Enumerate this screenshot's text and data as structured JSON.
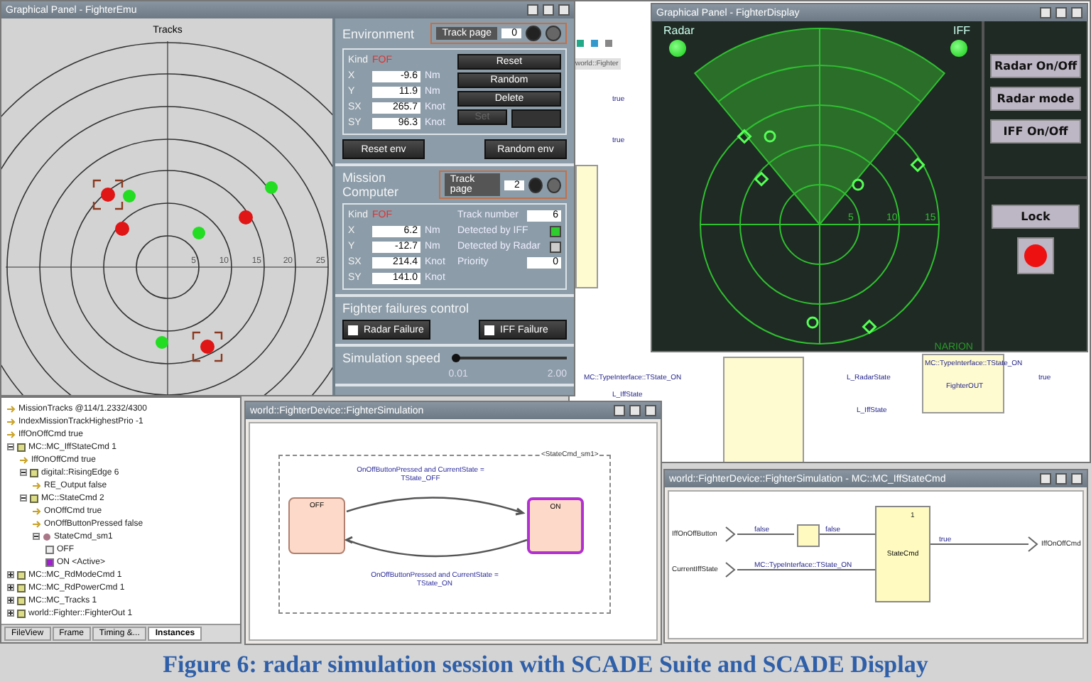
{
  "emu_window": {
    "title": "Graphical Panel - FighterEmu",
    "radar": {
      "title": "Tracks",
      "ticks": [
        "5",
        "10",
        "15",
        "20",
        "25"
      ]
    },
    "environment": {
      "title": "Environment",
      "track_page_label": "Track page",
      "track_page": "0",
      "kind_label": "Kind",
      "kind": "FOF",
      "fields": [
        {
          "label": "X",
          "value": "-9.6",
          "unit": "Nm"
        },
        {
          "label": "Y",
          "value": "11.9",
          "unit": "Nm"
        },
        {
          "label": "SX",
          "value": "265.7",
          "unit": "Knot"
        },
        {
          "label": "SY",
          "value": "96.3",
          "unit": "Knot"
        }
      ],
      "buttons": [
        {
          "label": "Reset",
          "disabled": false
        },
        {
          "label": "Random",
          "disabled": false
        },
        {
          "label": "Delete",
          "disabled": false
        }
      ],
      "set_button": {
        "label": "Set",
        "disabled": true
      },
      "actions": [
        "Reset env",
        "Random env"
      ]
    },
    "mission_computer": {
      "title": "Mission Computer",
      "track_page_label": "Track page",
      "track_page": "2",
      "kind_label": "Kind",
      "kind": "FOF",
      "fields": [
        {
          "label": "X",
          "value": "6.2",
          "unit": "Nm"
        },
        {
          "label": "Y",
          "value": "-12.7",
          "unit": "Nm"
        },
        {
          "label": "SX",
          "value": "214.4",
          "unit": "Knot"
        },
        {
          "label": "SY",
          "value": "141.0",
          "unit": "Knot"
        }
      ],
      "props": [
        {
          "kind": "number",
          "label": "Track number",
          "value": "6"
        },
        {
          "kind": "check",
          "label": "Detected by IFF",
          "checked": true
        },
        {
          "kind": "check",
          "label": "Detected by Radar",
          "checked": false
        },
        {
          "kind": "number",
          "label": "Priority",
          "value": "0"
        }
      ]
    },
    "failures": {
      "title": "Fighter failures control",
      "items": [
        {
          "label": "Radar Failure",
          "checked": false
        },
        {
          "label": "IFF Failure",
          "checked": false
        }
      ]
    },
    "speed": {
      "title": "Simulation speed",
      "level": 0.02,
      "min": "0.01",
      "max": "2.00"
    }
  },
  "display_window": {
    "title": "Graphical Panel - FighterDisplay",
    "lamps": [
      {
        "label": "Radar",
        "on": true
      },
      {
        "label": "IFF",
        "on": true
      }
    ],
    "ticks": [
      "5",
      "10",
      "15"
    ],
    "brand": "NARION",
    "buttons": [
      "Radar On/Off",
      "Radar mode",
      "IFF On/Off"
    ],
    "lock": {
      "label": "Lock",
      "on": true
    }
  },
  "editor_window": {
    "tab": "world::Fighter",
    "labels": [
      "true",
      "true",
      "MC::TypeInterface::TState_ON",
      "L_IffState",
      "L_RadarState",
      "L_IffState",
      "MC::TypeInterface::TState_ON",
      "FighterOUT",
      "true"
    ]
  },
  "tree_window": {
    "items": [
      {
        "kind": "value",
        "label": "MissionTracks @114/1.2332/4300"
      },
      {
        "kind": "value",
        "label": "IndexMissionTrackHighestPrio -1"
      },
      {
        "kind": "value",
        "label": "IffOnOffCmd true"
      },
      {
        "kind": "group",
        "label": "MC::MC_IffStateCmd 1",
        "expanded": true,
        "children": [
          {
            "kind": "value",
            "label": "IffOnOffCmd true"
          },
          {
            "kind": "group",
            "label": "digital::RisingEdge 6",
            "expanded": true,
            "children": [
              {
                "kind": "value",
                "label": "RE_Output false"
              }
            ]
          },
          {
            "kind": "group",
            "label": "MC::StateCmd 2",
            "expanded": true,
            "children": [
              {
                "kind": "value",
                "label": "OnOffCmd true"
              },
              {
                "kind": "value",
                "label": "OnOffButtonPressed false"
              },
              {
                "kind": "machine",
                "label": "StateCmd_sm1",
                "expanded": true,
                "children": [
                  {
                    "kind": "state",
                    "label": "OFF",
                    "active": false
                  },
                  {
                    "kind": "state",
                    "label": "ON <Active>",
                    "active": true
                  }
                ]
              }
            ]
          }
        ]
      },
      {
        "kind": "group",
        "label": "MC::MC_RdModeCmd 1",
        "expanded": false
      },
      {
        "kind": "group",
        "label": "MC::MC_RdPowerCmd 1",
        "expanded": false
      },
      {
        "kind": "group",
        "label": "MC::MC_Tracks 1",
        "expanded": false
      },
      {
        "kind": "group",
        "label": "world::Fighter::FighterOut 1",
        "expanded": false
      }
    ],
    "tabs": [
      {
        "label": "FileView",
        "selected": false
      },
      {
        "label": "Frame",
        "selected": false
      },
      {
        "label": "Timing &...",
        "selected": false
      },
      {
        "label": "Instances",
        "selected": true
      }
    ]
  },
  "state_window": {
    "title": "world::FighterDevice::FighterSimulation",
    "machine": "<StateCmd_sm1>",
    "states": [
      {
        "label": "OFF",
        "selected": false
      },
      {
        "label": "ON",
        "selected": true
      }
    ],
    "transitions": [
      "OnOffButtonPressed and CurrentState = TState_OFF",
      "OnOffButtonPressed and CurrentState = TState_ON"
    ]
  },
  "diagram_window": {
    "title": "world::FighterDevice::FighterSimulation - MC::MC_IffStateCmd",
    "inputs": [
      "IffOnOffButton",
      "CurrentIffState"
    ],
    "wire_labels": [
      "false",
      "false",
      "MC::TypeInterface::TState_ON",
      "true"
    ],
    "block": "StateCmd",
    "block_index": "1",
    "output": "IffOnOffCmd"
  },
  "caption": "Figure 6: radar simulation session with SCADE Suite and SCADE Display"
}
